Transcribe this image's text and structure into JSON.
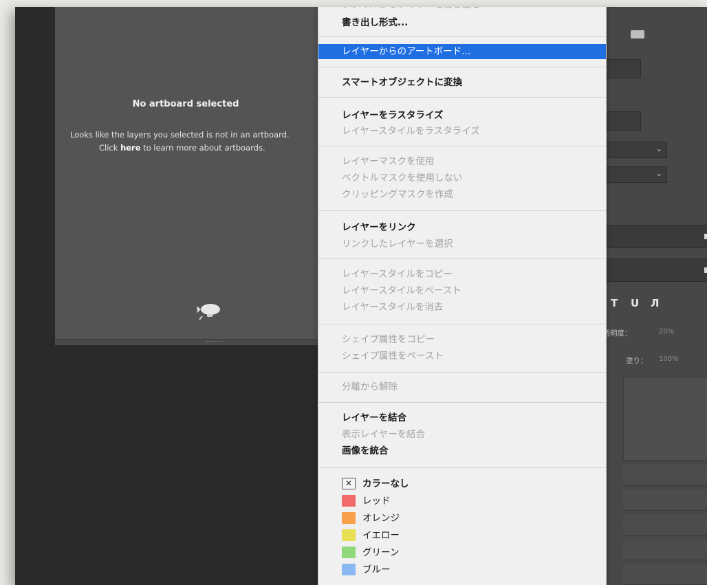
{
  "artboard": {
    "title": "No artboard selected",
    "line1": "Looks like the layers you selected is not in an artboard.",
    "line2_prefix": "Click ",
    "line2_link": "here",
    "line2_suffix": " to learn more about artboards."
  },
  "menu": {
    "top_partial": "ファイルからレイヤーを書き出し",
    "items": [
      {
        "label": "書き出し形式...",
        "state": "bold"
      },
      {
        "label": "レイヤーからのアートボード...",
        "state": "highlight"
      },
      {
        "label": "スマートオブジェクトに変換",
        "state": "bold"
      },
      {
        "label": "レイヤーをラスタライズ",
        "state": "bold"
      },
      {
        "label": "レイヤースタイルをラスタライズ",
        "state": "disabled"
      },
      {
        "label": "レイヤーマスクを使用",
        "state": "disabled"
      },
      {
        "label": "ベクトルマスクを使用しない",
        "state": "disabled"
      },
      {
        "label": "クリッピングマスクを作成",
        "state": "disabled"
      },
      {
        "label": "レイヤーをリンク",
        "state": "bold"
      },
      {
        "label": "リンクしたレイヤーを選択",
        "state": "disabled"
      },
      {
        "label": "レイヤースタイルをコピー",
        "state": "disabled"
      },
      {
        "label": "レイヤースタイルをペースト",
        "state": "disabled"
      },
      {
        "label": "レイヤースタイルを消去",
        "state": "disabled"
      },
      {
        "label": "シェイプ属性をコピー",
        "state": "disabled"
      },
      {
        "label": "シェイプ属性をペースト",
        "state": "disabled"
      },
      {
        "label": "分離から解除",
        "state": "disabled"
      },
      {
        "label": "レイヤーを結合",
        "state": "bold"
      },
      {
        "label": "表示レイヤーを結合",
        "state": "disabled"
      },
      {
        "label": "画像を統合",
        "state": "bold"
      }
    ],
    "colors": [
      {
        "label": "カラーなし",
        "swatch": "none"
      },
      {
        "label": "レッド",
        "swatch": "#f26b6b"
      },
      {
        "label": "オレンジ",
        "swatch": "#f7a04a"
      },
      {
        "label": "イエロー",
        "swatch": "#e8df55"
      },
      {
        "label": "グリーン",
        "swatch": "#8fd97a"
      },
      {
        "label": "ブルー",
        "swatch": "#8ab8f2"
      }
    ]
  },
  "right_panel": {
    "tools": [
      "T",
      "U",
      "Л"
    ],
    "opacity_label": "不透明度：",
    "opacity_value": "20%",
    "fill_label": "塗り：",
    "fill_value": "100%"
  },
  "colors": {
    "highlight": "#1f6fe3",
    "menu_bg": "#f0f0f0",
    "app_bg": "#2a2a2a"
  }
}
